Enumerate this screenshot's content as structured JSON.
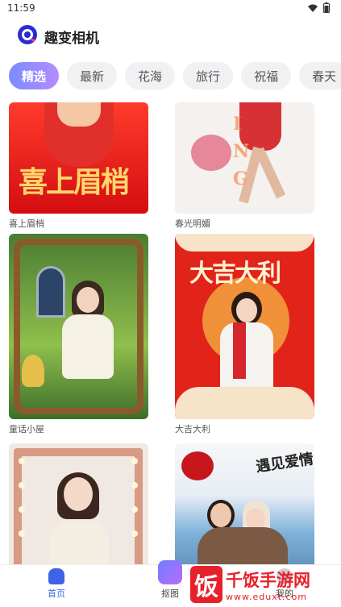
{
  "status": {
    "time": "11:59"
  },
  "app": {
    "title": "趣变相机"
  },
  "tabs": [
    "精选",
    "最新",
    "花海",
    "旅行",
    "祝福",
    "春天"
  ],
  "cards": [
    {
      "caption": "喜上眉梢",
      "art": "喜上眉梢"
    },
    {
      "caption": "春光明媚",
      "art": "ING"
    },
    {
      "caption": "童话小屋"
    },
    {
      "caption": "大吉大利",
      "art": "大吉大利"
    },
    {
      "caption": ""
    },
    {
      "caption": "",
      "art": "遇见爱情"
    }
  ],
  "bottom_nav": {
    "home": "首页",
    "cutout": "抠图",
    "mine": "我的"
  },
  "watermark": {
    "text": "千饭手游网",
    "url": "www.eduxt.com",
    "badge": "饭"
  },
  "colors": {
    "accent": "#3e63e8",
    "tab_active": "#8c8cff"
  }
}
